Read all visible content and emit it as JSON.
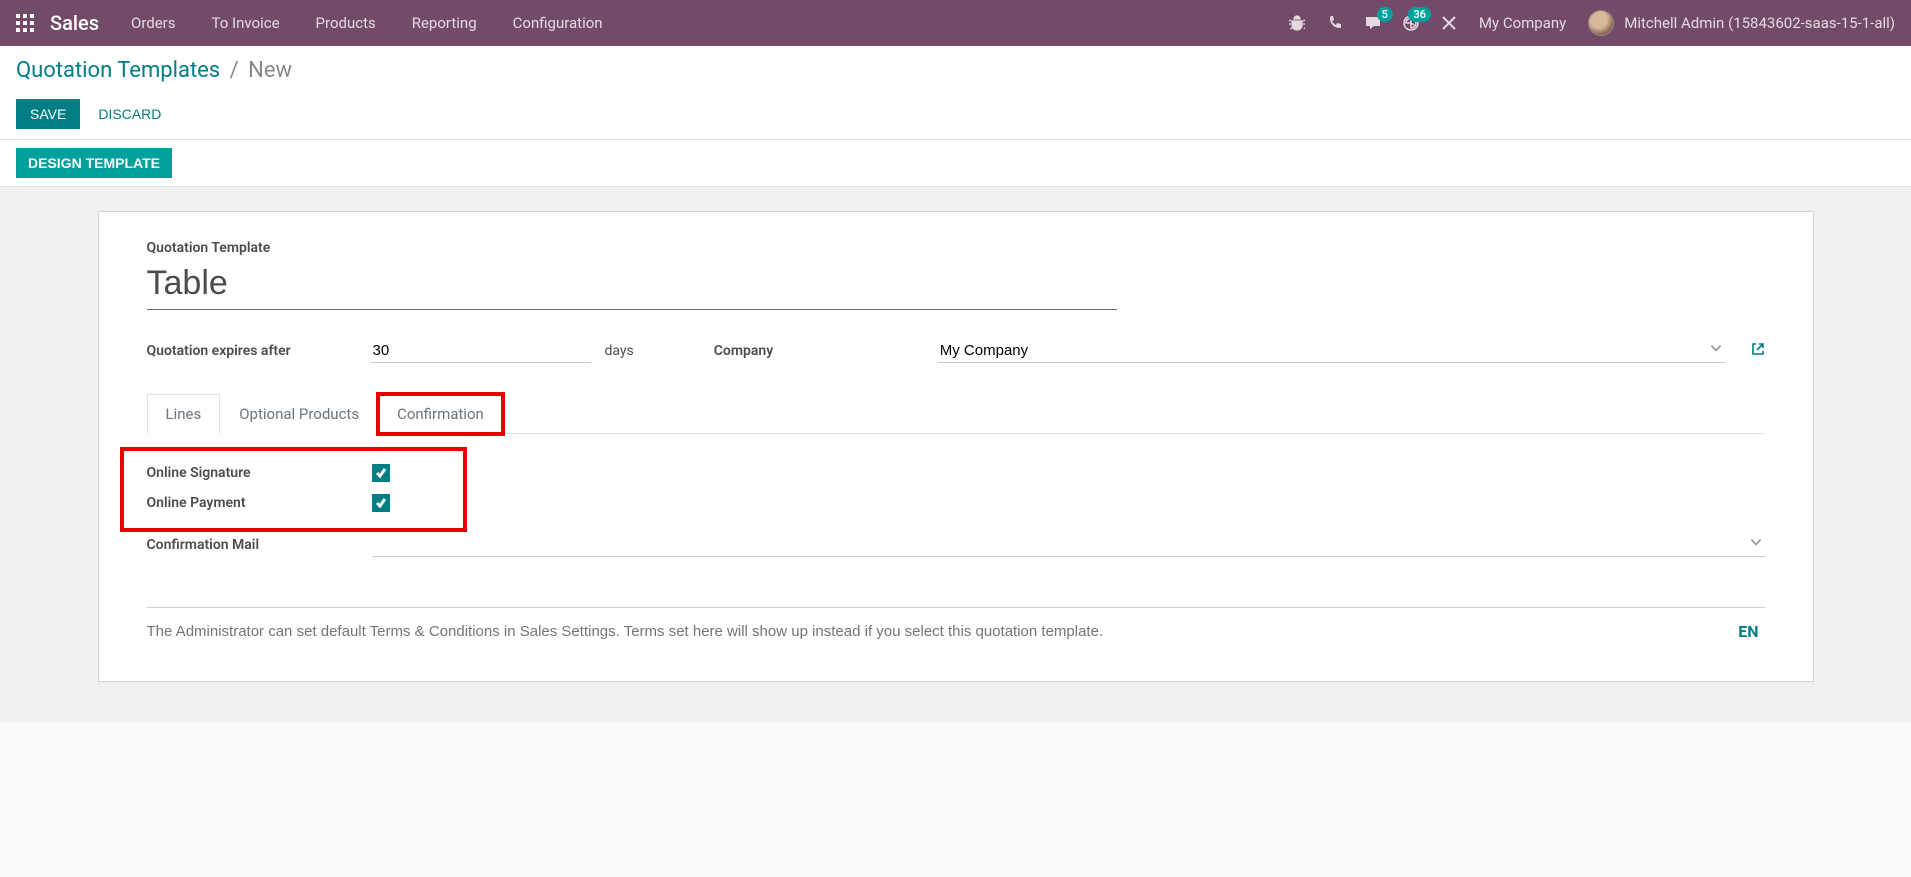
{
  "navbar": {
    "brand": "Sales",
    "menu": [
      "Orders",
      "To Invoice",
      "Products",
      "Reporting",
      "Configuration"
    ],
    "messages_badge": "5",
    "activities_badge": "36",
    "company": "My Company",
    "username": "Mitchell Admin (15843602-saas-15-1-all)"
  },
  "breadcrumb": {
    "parent": "Quotation Templates",
    "current": "New"
  },
  "buttons": {
    "save": "Save",
    "discard": "Discard",
    "design_template": "Design Template"
  },
  "form": {
    "title_label": "Quotation Template",
    "title_value": "Table",
    "expires_label": "Quotation expires after",
    "expires_value": "30",
    "expires_unit": "days",
    "company_label": "Company",
    "company_value": "My Company"
  },
  "tabs": [
    "Lines",
    "Optional Products",
    "Confirmation"
  ],
  "confirmation": {
    "online_signature_label": "Online Signature",
    "online_payment_label": "Online Payment",
    "confirmation_mail_label": "Confirmation Mail",
    "confirmation_mail_value": ""
  },
  "terms": {
    "placeholder": "The Administrator can set default Terms & Conditions in Sales Settings. Terms set here will show up instead if you select this quotation template.",
    "lang": "EN"
  }
}
